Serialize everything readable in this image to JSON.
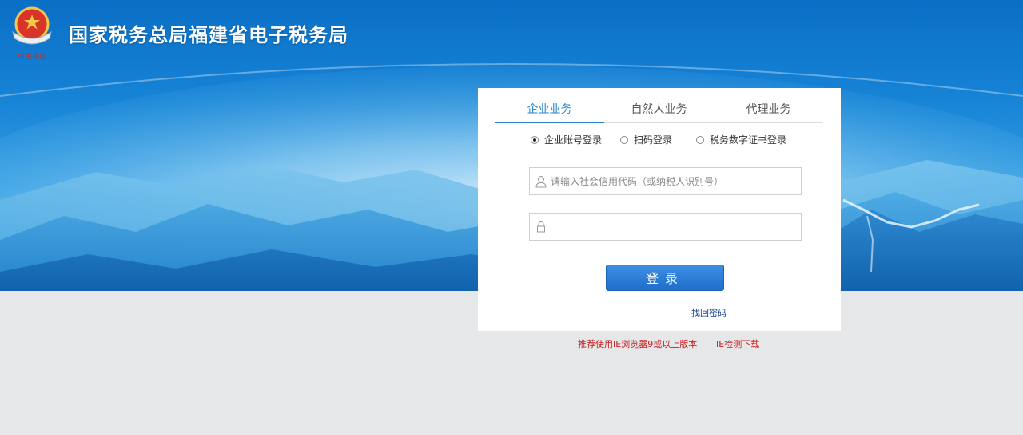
{
  "header": {
    "title": "国家税务总局福建省电子税务局",
    "logo_caption": "中国税务",
    "logo_icon": "tax-emblem-icon"
  },
  "login": {
    "tabs": [
      {
        "label": "企业业务",
        "active": true
      },
      {
        "label": "自然人业务",
        "active": false
      },
      {
        "label": "代理业务",
        "active": false
      }
    ],
    "methods": [
      {
        "label": "企业账号登录",
        "checked": true
      },
      {
        "label": "扫码登录",
        "checked": false
      },
      {
        "label": "税务数字证书登录",
        "checked": false
      }
    ],
    "username_placeholder": "请输入社会信用代码（或纳税人识别号）",
    "username_icon": "user-icon",
    "password_placeholder": "",
    "password_icon": "lock-icon",
    "submit_label": "登录",
    "forgot_link": "找回密码"
  },
  "footer": {
    "browser_note": "推荐使用IE浏览器9或以上版本",
    "ie_check_link": "IE检测下载"
  },
  "colors": {
    "accent": "#2a86cf",
    "button": "#1f6fcb",
    "warning_text": "#c81e1e",
    "link": "#1a3f8c",
    "page_bg": "#e6e7e8"
  }
}
